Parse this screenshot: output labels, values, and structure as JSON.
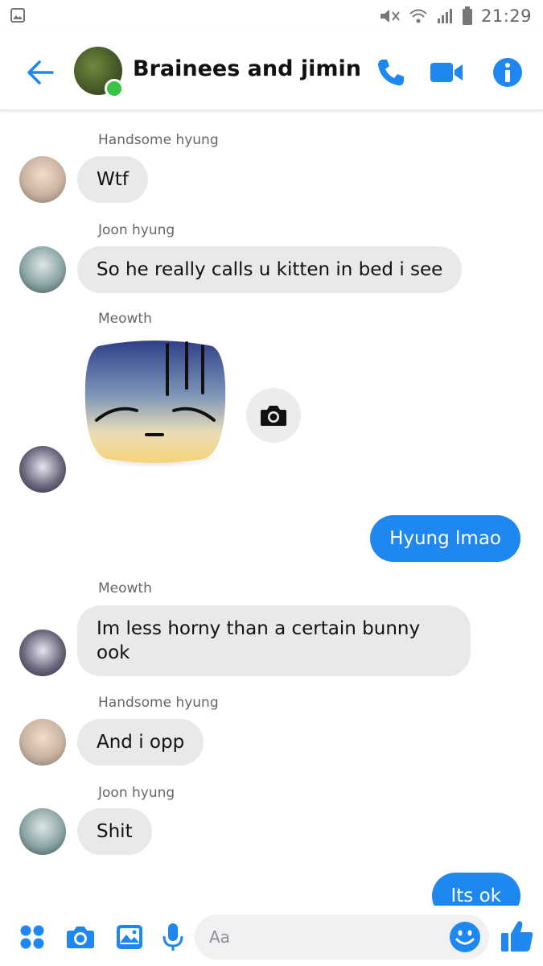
{
  "status_bar": {
    "time": "21:29"
  },
  "header": {
    "title": "Brainees and jimin",
    "icons": [
      "back-arrow-icon",
      "phone-icon",
      "video-camera-icon",
      "info-icon"
    ]
  },
  "messages": [
    {
      "sender": "Handsome hyung",
      "text": "Wtf"
    },
    {
      "sender": "Joon hyung",
      "text": "So he really calls u kitten in bed i see"
    },
    {
      "sender": "Meowth",
      "sticker": "tired-face-sticker"
    },
    {
      "outgoing": true,
      "text": "Hyung lmao"
    },
    {
      "sender": "Meowth",
      "text_line1": "Im less horny than a certain bunny",
      "text_line2": "ook"
    },
    {
      "sender": "Handsome hyung",
      "text": "And i opp"
    },
    {
      "sender": "Joon hyung",
      "text": "Shit"
    },
    {
      "outgoing": true,
      "text": "Its ok"
    }
  ],
  "composer": {
    "placeholder": "Aa",
    "icons": [
      "apps-grid-icon",
      "camera-icon",
      "gallery-icon",
      "microphone-icon",
      "emoji-icon",
      "thumbs-up-icon"
    ]
  },
  "colors": {
    "accent": "#1e88f0",
    "incoming_bubble": "#e9e9ea",
    "online": "#37c440"
  }
}
